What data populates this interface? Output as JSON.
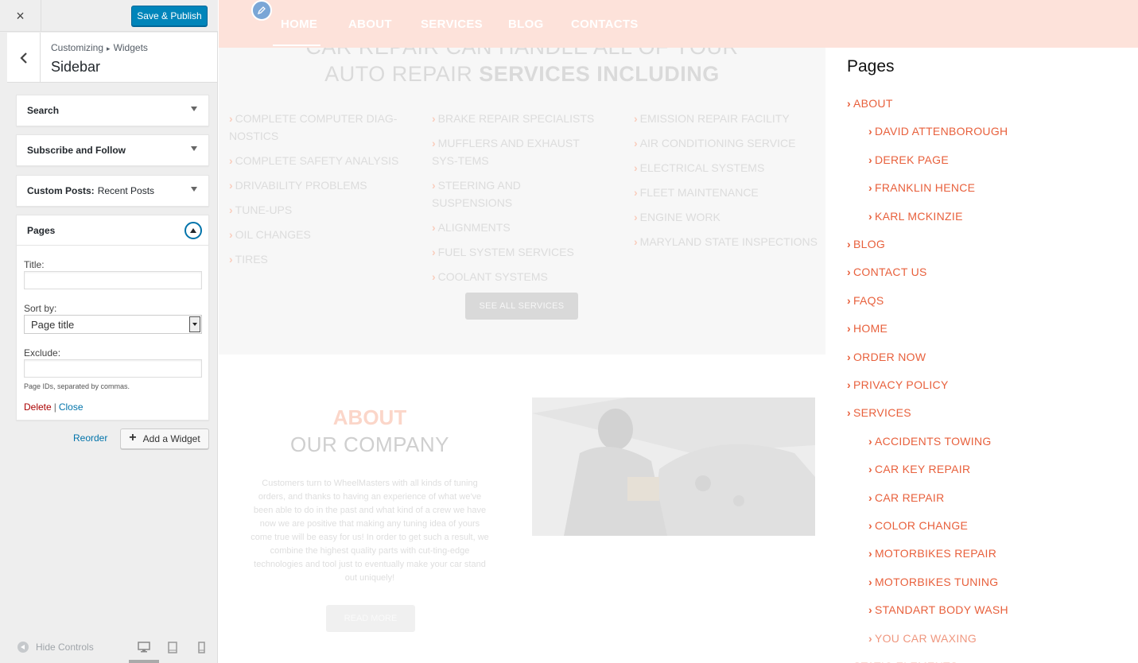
{
  "header": {
    "close_label": "×",
    "publish_label": "Save & Publish"
  },
  "section": {
    "breadcrumb_root": "Customizing",
    "breadcrumb_sep": "▸",
    "breadcrumb_current": "Widgets",
    "title": "Sidebar"
  },
  "widgets": [
    {
      "title": "Search",
      "subtitle": ""
    },
    {
      "title": "Subscribe and Follow",
      "subtitle": ""
    },
    {
      "title": "Custom Posts:",
      "subtitle": "Recent Posts"
    },
    {
      "title": "Pages",
      "subtitle": ""
    }
  ],
  "pages_widget": {
    "title_label": "Title:",
    "title_value": "",
    "sortby_label": "Sort by:",
    "sortby_value": "Page title",
    "exclude_label": "Exclude:",
    "exclude_value": "",
    "hint": "Page IDs, separated by commas.",
    "delete_label": "Delete",
    "separator": "|",
    "close_label": "Close"
  },
  "panel_actions": {
    "reorder_label": "Reorder",
    "add_widget_label": "Add a Widget"
  },
  "footer": {
    "hide_controls_label": "Hide Controls",
    "devices": [
      "desktop-icon",
      "tablet-icon",
      "mobile-icon"
    ]
  },
  "preview": {
    "nav": [
      "HOME",
      "ABOUT",
      "SERVICES",
      "BLOG",
      "CONTACTS"
    ],
    "services_heading_line1": "CAR REPAIR CAN HANDLE ALL OF YOUR",
    "services_heading_line2_plain": "AUTO REPAIR ",
    "services_heading_line2_bold": "SERVICES INCLUDING",
    "services_col1": [
      "COMPLETE COMPUTER DIAG-NOSTICS",
      "COMPLETE SAFETY ANALYSIS",
      "DRIVABILITY PROBLEMS",
      "TUNE-UPS",
      "OIL CHANGES",
      "TIRES"
    ],
    "services_col2": [
      "BRAKE REPAIR SPECIALISTS",
      "MUFFLERS AND EXHAUST SYS-TEMS",
      "STEERING AND SUSPENSIONS",
      "ALIGNMENTS",
      "FUEL SYSTEM SERVICES",
      "COOLANT SYSTEMS"
    ],
    "services_col3": [
      "EMISSION REPAIR FACILITY",
      "AIR CONDITIONING SERVICE",
      "ELECTRICAL SYSTEMS",
      "FLEET MAINTENANCE",
      "ENGINE WORK",
      "MARYLAND STATE INSPECTIONS"
    ],
    "see_all_label": "SEE ALL SERVICES",
    "about_title": "ABOUT",
    "about_subtitle": "OUR COMPANY",
    "about_text": "Customers turn to WheelMasters with all kinds of tuning orders, and thanks to having an experience of what we've been able to do in the past and what kind of a crew we have now we are positive that making any tuning idea of yours come true will be easy for us! In order to get such a result, we combine the highest quality parts with cut-ting-edge technologies and tool just to eventually make your car stand out uniquely!",
    "read_more_label": "READ MORE",
    "sidebar_title": "Pages",
    "pages": [
      {
        "label": "ABOUT",
        "level": 0
      },
      {
        "label": "DAVID ATTENBOROUGH",
        "level": 1
      },
      {
        "label": "DEREK PAGE",
        "level": 1
      },
      {
        "label": "FRANKLIN HENCE",
        "level": 1
      },
      {
        "label": "KARL MCKINZIE",
        "level": 1
      },
      {
        "label": "BLOG",
        "level": 0
      },
      {
        "label": "CONTACT US",
        "level": 0
      },
      {
        "label": "FAQS",
        "level": 0
      },
      {
        "label": "HOME",
        "level": 0
      },
      {
        "label": "ORDER NOW",
        "level": 0
      },
      {
        "label": "PRIVACY POLICY",
        "level": 0
      },
      {
        "label": "SERVICES",
        "level": 0
      },
      {
        "label": "ACCIDENTS TOWING",
        "level": 1
      },
      {
        "label": "CAR KEY REPAIR",
        "level": 1
      },
      {
        "label": "CAR REPAIR",
        "level": 1
      },
      {
        "label": "COLOR CHANGE",
        "level": 1
      },
      {
        "label": "MOTORBIKES REPAIR",
        "level": 1
      },
      {
        "label": "MOTORBIKES TUNING",
        "level": 1
      },
      {
        "label": "STANDART BODY WASH",
        "level": 1
      },
      {
        "label": "YOU CAR WAXING",
        "level": 1
      },
      {
        "label": "STATIC ELEMENTS",
        "level": 0
      }
    ]
  },
  "colors": {
    "accent": "#e8603c",
    "publish": "#0085ba",
    "nav_bg": "#fde2da"
  }
}
